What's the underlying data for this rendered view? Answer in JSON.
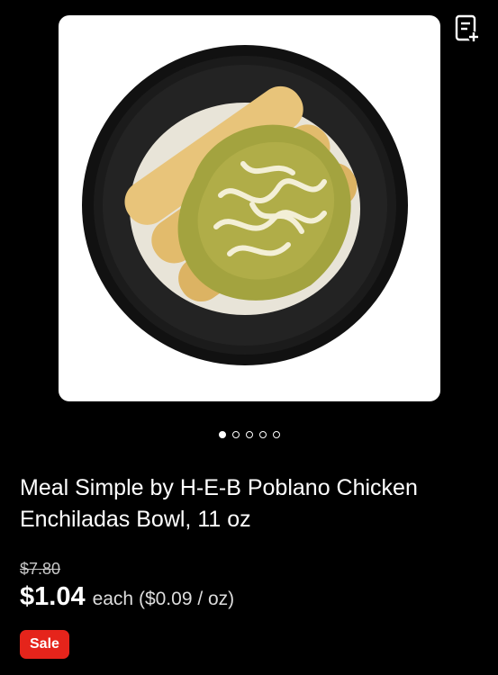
{
  "product": {
    "title": "Meal Simple by H-E-B Poblano Chicken Enchiladas Bowl, 11 oz",
    "old_price": "$7.80",
    "price": "$1.04",
    "unit_price": "each ($0.09 / oz)",
    "badge": "Sale",
    "image_alt": "Poblano chicken enchiladas bowl"
  },
  "carousel": {
    "image_count": 5,
    "active_index": 0
  },
  "icons": {
    "add_to_list": "list-add-icon"
  },
  "colors": {
    "background": "#000000",
    "sale_badge": "#e5241b",
    "text": "#ffffff"
  }
}
